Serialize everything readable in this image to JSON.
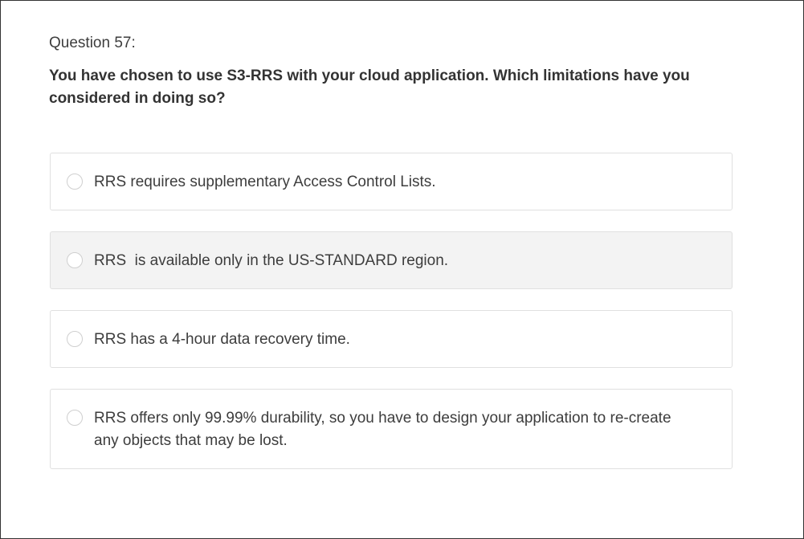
{
  "question": {
    "number_label": "Question 57:",
    "text": "You have chosen to use S3-RRS with your cloud application. Which limitations have you considered in doing so?"
  },
  "options": [
    {
      "label": "RRS requires supplementary Access Control Lists.",
      "selected": false,
      "hovered": false
    },
    {
      "label": "RRS  is available only in the US-STANDARD region.",
      "selected": false,
      "hovered": true
    },
    {
      "label": "RRS has a 4-hour data recovery time.",
      "selected": false,
      "hovered": false
    },
    {
      "label": "RRS offers only 99.99% durability, so you have to design your application to re-create any objects that may be lost.",
      "selected": false,
      "hovered": false
    }
  ],
  "colors": {
    "hover_background": "#f3f3f3",
    "border": "#e0e0e0",
    "text": "#3d3d3d"
  }
}
